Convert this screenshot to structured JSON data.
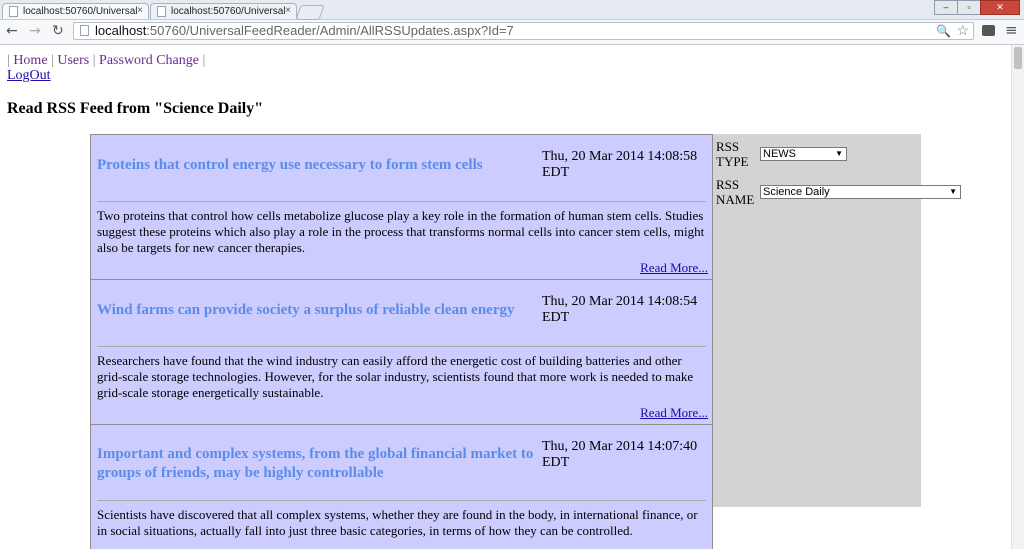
{
  "browser": {
    "tabs": [
      {
        "label": "localhost:50760/Universal"
      },
      {
        "label": "localhost:50760/Universal"
      }
    ],
    "url_host": "localhost",
    "url_rest": ":50760/UniversalFeedReader/Admin/AllRSSUpdates.aspx?Id=7",
    "close_glyph": "×"
  },
  "nav": {
    "links": [
      "Home",
      "Users",
      "Password Change"
    ],
    "logout": "LogOut"
  },
  "page_title": "Read RSS Feed from \"Science Daily\"",
  "feed": {
    "items": [
      {
        "title": "Proteins that control energy use necessary to form stem cells",
        "date": "Thu, 20 Mar 2014 14:08:58 EDT",
        "description": "Two proteins that control how cells metabolize glucose play a key role in the formation of human stem cells. Studies suggest these proteins which also play a role in the process that transforms normal cells into cancer stem cells, might also be targets for new cancer therapies.",
        "read_more": "Read More..."
      },
      {
        "title": "Wind farms can provide society a surplus of reliable clean energy",
        "date": "Thu, 20 Mar 2014 14:08:54 EDT",
        "description": "Researchers have found that the wind industry can easily afford the energetic cost of building batteries and other grid-scale storage technologies. However, for the solar industry, scientists found that more work is needed to make grid-scale storage energetically sustainable.",
        "read_more": "Read More..."
      },
      {
        "title": "Important and complex systems, from the global financial market to groups of friends, may be highly controllable",
        "date": "Thu, 20 Mar 2014 14:07:40 EDT",
        "description": "Scientists have discovered that all complex systems, whether they are found in the body, in international finance, or in social situations, actually fall into just three basic categories, in terms of how they can be controlled."
      }
    ]
  },
  "filter": {
    "type_label": "RSS TYPE",
    "type_value": "NEWS",
    "name_label": "RSS NAME",
    "name_value": "Science Daily"
  }
}
